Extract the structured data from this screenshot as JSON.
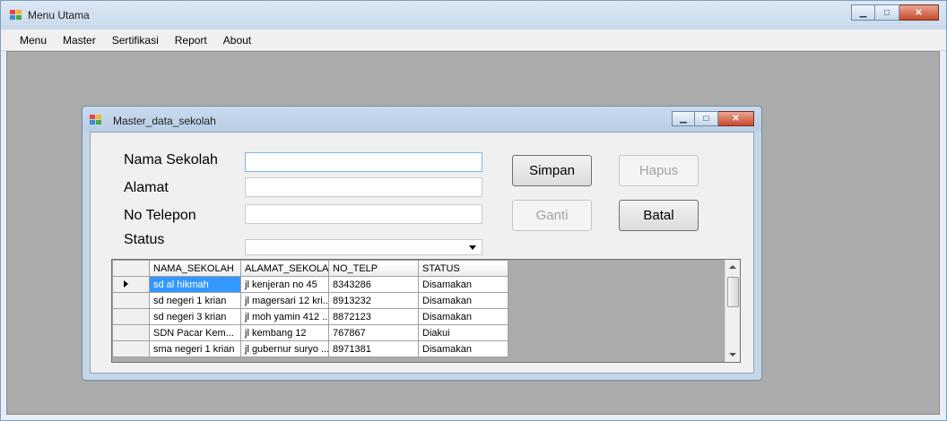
{
  "window": {
    "title": "Menu Utama"
  },
  "menu": [
    "Menu",
    "Master",
    "Sertifikasi",
    "Report",
    "About"
  ],
  "child": {
    "title": "Master_data_sekolah",
    "labels": {
      "nama": "Nama Sekolah",
      "alamat": "Alamat",
      "telepon": "No Telepon",
      "status": "Status"
    },
    "inputs": {
      "nama": "",
      "alamat": "",
      "telepon": "",
      "status": ""
    },
    "buttons": {
      "simpan": "Simpan",
      "hapus": "Hapus",
      "ganti": "Ganti",
      "batal": "Batal"
    }
  },
  "grid": {
    "columns": [
      "NAMA_SEKOLAH",
      "ALAMAT_SEKOLA",
      "NO_TELP",
      "STATUS"
    ],
    "rows": [
      [
        "sd al hikmah",
        "jl kenjeran no 45",
        "8343286",
        "Disamakan"
      ],
      [
        "sd negeri 1 krian",
        "jl magersari 12 kri...",
        "8913232",
        "Disamakan"
      ],
      [
        "sd negeri 3 krian",
        "jl moh yamin 412 ...",
        "8872123",
        "Disamakan"
      ],
      [
        "SDN Pacar Kem...",
        "jl kembang 12",
        "767867",
        "Diakui"
      ],
      [
        "sma negeri 1 krian",
        "jl gubernur suryo ...",
        "8971381",
        "Disamakan"
      ]
    ]
  },
  "colors": {
    "selection": "#3399ff",
    "mdi_background": "#ababab"
  }
}
